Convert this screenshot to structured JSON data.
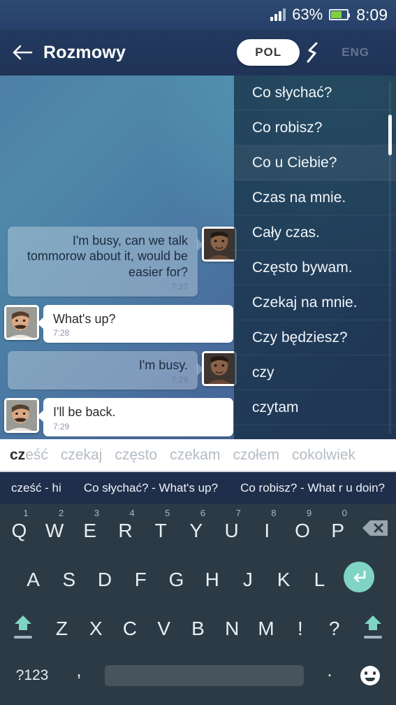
{
  "status_bar": {
    "battery_percent": "63%",
    "time": "8:09",
    "signal_icon": "signal-bars-icon",
    "battery_icon": "battery-icon",
    "battery_color": "#7fcf3f"
  },
  "app_bar": {
    "back_icon": "back-arrow-icon",
    "title": "Rozmowy",
    "lang_active": "POL",
    "lang_swap_icon": "swap-languages-icon",
    "lang_inactive": "ENG",
    "active_pill_color": "#ffffff",
    "inactive_text_color": "#64748f"
  },
  "chat": {
    "messages": [
      {
        "direction": "out",
        "text": "I'm busy, can we talk tommorow about it, would be easier for?",
        "time": "7:27",
        "avatar": "avatar-contact-man"
      },
      {
        "direction": "in",
        "text": "What's up?",
        "time": "7:28",
        "avatar": "avatar-user-mustache"
      },
      {
        "direction": "out",
        "text": "I'm busy.",
        "time": "7:29",
        "avatar": "avatar-contact-man"
      },
      {
        "direction": "in",
        "text": "I'll be back.",
        "time": "7:29",
        "avatar": "avatar-user-mustache"
      }
    ]
  },
  "suggestion_panel": {
    "items": [
      "Co słychać?",
      "Co robisz?",
      "Co u Ciebie?",
      "Czas na mnie.",
      "Cały czas.",
      "Często bywam.",
      "Czekaj na mnie.",
      "Czy będziesz?",
      "czy",
      "czytam"
    ],
    "scrollbar": "vertical-scrollbar"
  },
  "word_strip": {
    "words": [
      {
        "prefix": "cz",
        "rest": "eść"
      },
      {
        "prefix": "",
        "rest": "czekaj"
      },
      {
        "prefix": "",
        "rest": "często"
      },
      {
        "prefix": "",
        "rest": "czekam"
      },
      {
        "prefix": "",
        "rest": "czołem"
      },
      {
        "prefix": "",
        "rest": "cokolwiek"
      }
    ]
  },
  "translation_bar": {
    "items": [
      "cześć - hi",
      "Co słychać? - What's up?",
      "Co robisz? - What r u doin?"
    ]
  },
  "keyboard": {
    "row1": [
      {
        "key": "Q",
        "num": "1"
      },
      {
        "key": "W",
        "num": "2"
      },
      {
        "key": "E",
        "num": "3"
      },
      {
        "key": "R",
        "num": "4"
      },
      {
        "key": "T",
        "num": "5"
      },
      {
        "key": "Y",
        "num": "6"
      },
      {
        "key": "U",
        "num": "7"
      },
      {
        "key": "I",
        "num": "8"
      },
      {
        "key": "O",
        "num": "9"
      },
      {
        "key": "P",
        "num": "0"
      }
    ],
    "backspace_icon": "backspace-icon",
    "row2": [
      "A",
      "S",
      "D",
      "F",
      "G",
      "H",
      "J",
      "K",
      "L"
    ],
    "enter_icon": "enter-return-icon",
    "enter_color": "#7fd4c4",
    "row3": [
      "Z",
      "X",
      "C",
      "V",
      "B",
      "N",
      "M",
      "!",
      "?"
    ],
    "shift_icon": "shift-caps-icon",
    "symbols_label": "?123",
    "comma_label": ",",
    "space_label": "",
    "period_label": ".",
    "emoji_icon": "emoji-smiley-icon"
  }
}
